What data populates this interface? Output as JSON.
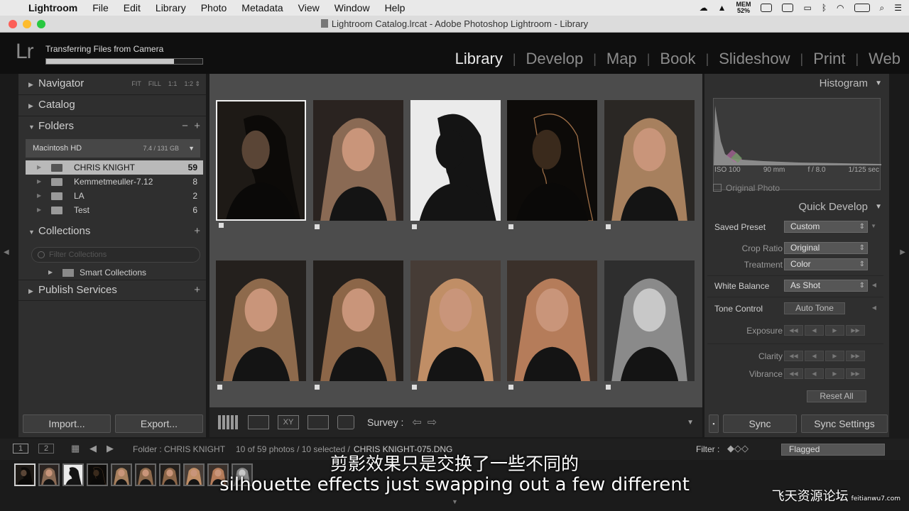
{
  "menubar": {
    "app": "Lightroom",
    "items": [
      "File",
      "Edit",
      "Library",
      "Photo",
      "Metadata",
      "View",
      "Window",
      "Help"
    ],
    "mem_label": "MEM",
    "mem_value": "52%"
  },
  "window": {
    "title": "Lightroom Catalog.lrcat - Adobe Photoshop Lightroom - Library"
  },
  "identity": {
    "logo": "Lr",
    "transfer_text": "Transferring Files from Camera",
    "transfer_progress": 0.82
  },
  "modules": [
    "Library",
    "Develop",
    "Map",
    "Book",
    "Slideshow",
    "Print",
    "Web"
  ],
  "left_panel": {
    "navigator": {
      "label": "Navigator",
      "zoom_options": [
        "FIT",
        "FILL",
        "1:1",
        "1:2"
      ]
    },
    "catalog": {
      "label": "Catalog"
    },
    "folders": {
      "label": "Folders",
      "volume": {
        "name": "Macintosh HD",
        "usage": "7.4 / 131 GB"
      },
      "items": [
        {
          "name": "CHRIS KNIGHT",
          "count": "59",
          "selected": true
        },
        {
          "name": "Kemmetmeuller-7.12",
          "count": "8",
          "selected": false
        },
        {
          "name": "LA",
          "count": "2",
          "selected": false
        },
        {
          "name": "Test",
          "count": "6",
          "selected": false
        }
      ]
    },
    "collections": {
      "label": "Collections",
      "search_placeholder": "Filter Collections",
      "smart_collections": "Smart Collections"
    },
    "publish_services": {
      "label": "Publish Services"
    },
    "import_label": "Import...",
    "export_label": "Export..."
  },
  "grid": {
    "photos": [
      {
        "style": "dark-profile",
        "bg": "#1e1a16",
        "fg": "#5a4536",
        "selected": true
      },
      {
        "style": "portrait",
        "bg": "#2a2320",
        "fg": "#8a6a54",
        "selected": false
      },
      {
        "style": "silhouette",
        "bg": "#ebebeb",
        "fg": "#141414",
        "selected": false
      },
      {
        "style": "rim-light",
        "bg": "#0d0b09",
        "fg": "#3a2a1c",
        "selected": false
      },
      {
        "style": "portrait",
        "bg": "#2a2724",
        "fg": "#a7805e",
        "selected": false
      },
      {
        "style": "portrait",
        "bg": "#24201d",
        "fg": "#8e6a4c",
        "selected": false
      },
      {
        "style": "portrait",
        "bg": "#221e1b",
        "fg": "#8c6648",
        "selected": false
      },
      {
        "style": "portrait",
        "bg": "#463c36",
        "fg": "#c08e66",
        "selected": false
      },
      {
        "style": "portrait",
        "bg": "#3a302a",
        "fg": "#b57c5a",
        "selected": false
      },
      {
        "style": "bw",
        "bg": "#2e2e2e",
        "fg": "#b0b0b0",
        "selected": false
      }
    ]
  },
  "toolbar": {
    "survey_label": "Survey :"
  },
  "right_panel": {
    "histogram": {
      "label": "Histogram",
      "iso": "ISO 100",
      "focal": "90 mm",
      "aperture": "f / 8.0",
      "shutter": "1/125 sec",
      "original_photo": "Original Photo"
    },
    "quick_develop": {
      "label": "Quick Develop",
      "saved_preset_label": "Saved Preset",
      "saved_preset_value": "Custom",
      "crop_ratio_label": "Crop Ratio",
      "crop_ratio_value": "Original",
      "treatment_label": "Treatment",
      "treatment_value": "Color",
      "white_balance_label": "White Balance",
      "white_balance_value": "As Shot",
      "tone_control_label": "Tone Control",
      "auto_tone_label": "Auto Tone",
      "exposure_label": "Exposure",
      "clarity_label": "Clarity",
      "vibrance_label": "Vibrance",
      "reset_all_label": "Reset All"
    },
    "sync_label": "Sync",
    "sync_settings_label": "Sync Settings"
  },
  "filmbar": {
    "view1": "1",
    "view2": "2",
    "folder_text": "Folder : CHRIS KNIGHT",
    "status_text": "10 of 59 photos / 10 selected /",
    "file_text": "CHRIS KNIGHT-075.DNG",
    "filter_label": "Filter :",
    "filter_value": "Flagged"
  },
  "subtitles": {
    "cn": "剪影效果只是交换了一些不同的",
    "en": "silhouette effects just swapping out a few different"
  },
  "watermark": {
    "cn": "飞天资源论坛",
    "url": "feitianwu7.com"
  },
  "colors": {
    "accent": "#eaeaea",
    "panel": "#2f2f2f",
    "grid_bg": "#4c4c4c"
  }
}
